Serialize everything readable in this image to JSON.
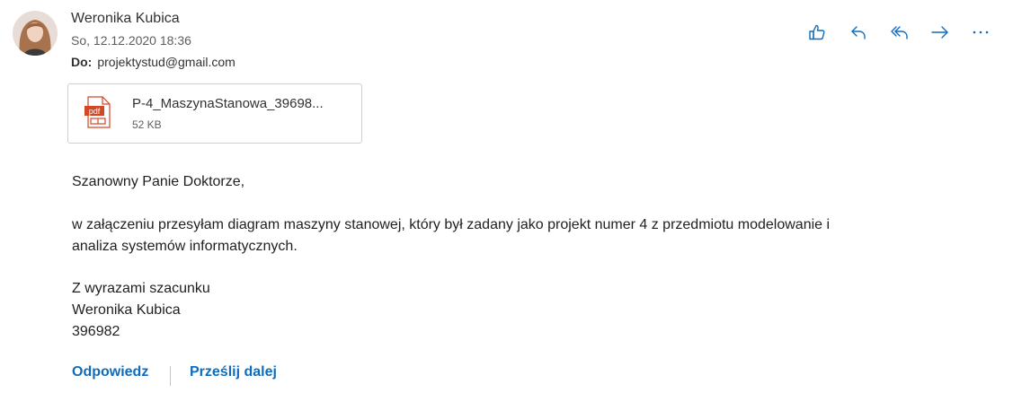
{
  "message": {
    "sender_name": "Weronika Kubica",
    "date": "So, 12.12.2020 18:36",
    "to_label": "Do:",
    "to_address": "projektystud@gmail.com"
  },
  "toolbar": {
    "actions": [
      {
        "name": "like",
        "icon": "thumbs-up-icon"
      },
      {
        "name": "reply",
        "icon": "reply-icon"
      },
      {
        "name": "reply-all",
        "icon": "reply-all-icon"
      },
      {
        "name": "forward",
        "icon": "forward-icon"
      },
      {
        "name": "more",
        "icon": "more-icon"
      }
    ],
    "icon_color": "#0f6cbd"
  },
  "attachment": {
    "file_name": "P-4_MaszynaStanowa_39698...",
    "file_size": "52 KB",
    "icon": "pdf-icon",
    "icon_label": "pdf",
    "icon_color": "#d24726"
  },
  "body": {
    "greeting": "Szanowny Panie Doktorze,",
    "paragraph_line1": "w załączeniu przesyłam diagram maszyny stanowej, który był zadany jako projekt numer 4 z przedmiotu modelowanie i",
    "paragraph_line2": "analiza systemów informatycznych.",
    "closing_line1": "Z wyrazami szacunku",
    "closing_line2": "Weronika Kubica",
    "closing_line3": "396982"
  },
  "footer": {
    "reply_label": "Odpowiedz",
    "forward_label": "Prześlij dalej"
  }
}
